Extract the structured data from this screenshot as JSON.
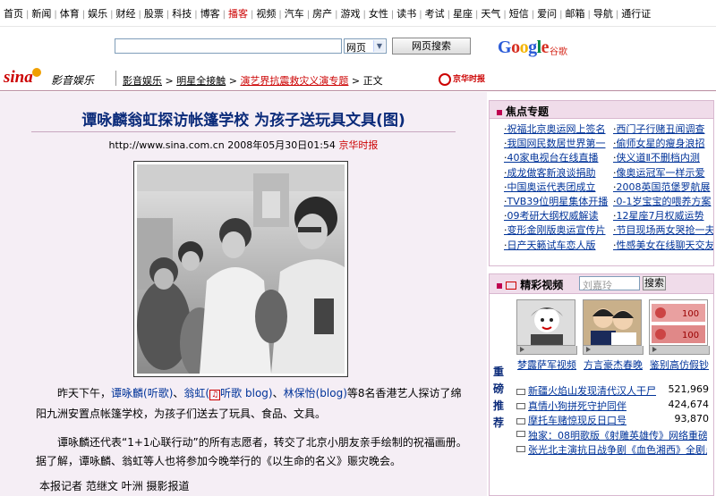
{
  "topnav": [
    "首页",
    "新闻",
    "体育",
    "娱乐",
    "财经",
    "股票",
    "科技",
    "博客",
    "播客",
    "视频",
    "汽车",
    "房产",
    "游戏",
    "女性",
    "读书",
    "考试",
    "星座",
    "天气",
    "短信",
    "爱问",
    "邮箱",
    "导航",
    "通行证"
  ],
  "search": {
    "select_value": "网页",
    "button_label": "网页搜索",
    "logo_suffix": "谷歌"
  },
  "header": {
    "logo": "sina",
    "channel": "影音娱乐",
    "breadcrumb": [
      "影音娱乐",
      "明星全接触",
      "演艺界抗震救灾义演专题"
    ],
    "breadcrumb_tail": "正文",
    "partner": "京华时报"
  },
  "article": {
    "title": "谭咏麟翁虹探访帐篷学校 为孩子送玩具文具(图)",
    "source_url": "http://www.sina.com.cn",
    "datetime": "2008年05月30日01:54",
    "source": "京华时报",
    "p1_pre": "昨天下午，",
    "p1_link1": "谭咏麟(听歌)",
    "p1_sep": "、",
    "p1_link2": "翁虹(",
    "p1_link2b": "听歌 blog)",
    "p1_sep2": "、",
    "p1_link3": "林保怡(blog)",
    "p1_post": "等8名香港艺人探访了绵阳九洲安置点帐篷学校，为孩子们送去了玩具、食品、文具。",
    "p2": "谭咏麟还代表“1+1心联行动”的所有志愿者，转交了北京小朋友亲手绘制的祝福画册。据了解，谭咏麟、翁虹等人也将参加今晚举行的《以生命的名义》赈灾晚会。",
    "p3": "本报记者 范继文 叶洲 摄影报道"
  },
  "focus": {
    "title": "焦点专题",
    "col1": [
      "祝福北京奥运网上签名",
      "我国网民数居世界第一",
      "40家电视台在线直播",
      "成龙做客新浪谈捐助",
      "中国奥运代表团成立",
      "TVB39位明星集体开播",
      "09考研大纲权威解读",
      "变形金刚版奥运宣传片",
      "日产天籁试车恋人版"
    ],
    "col2": [
      "西门子行赌丑闻调查",
      "偷师女星的瘦身浪招",
      "侠义道Ⅱ不删档内测",
      "像奥运冠军一样示爱",
      "2008英国范堡罗航展",
      "0-1岁宝宝的喂养方案",
      "12星座7月权威运势",
      "节目现场两女哭抢一夫",
      "性感美女在线聊天交友"
    ]
  },
  "video": {
    "title": "精彩视频",
    "search_placeholder": "刘嘉玲",
    "search_button": "搜索",
    "side_label": "重磅推荐",
    "thumbs": [
      "梦露萨军视频",
      "方言豪杰春晚",
      "鉴别高仿假钞"
    ],
    "list": [
      {
        "title": "新疆火焰山发现清代汉人干尸",
        "count": "521,969"
      },
      {
        "title": "真情小狗拼死守护同伴",
        "count": "424,674"
      },
      {
        "title": "摩托车赌惊现反日口号",
        "count": "93,870"
      },
      {
        "title": "独家：08明歌版《射雕英雄传》网络重磅首",
        "count": ""
      },
      {
        "title": "张光北主演抗日战争剧《血色湘西》全剧点播",
        "count": ""
      }
    ]
  }
}
